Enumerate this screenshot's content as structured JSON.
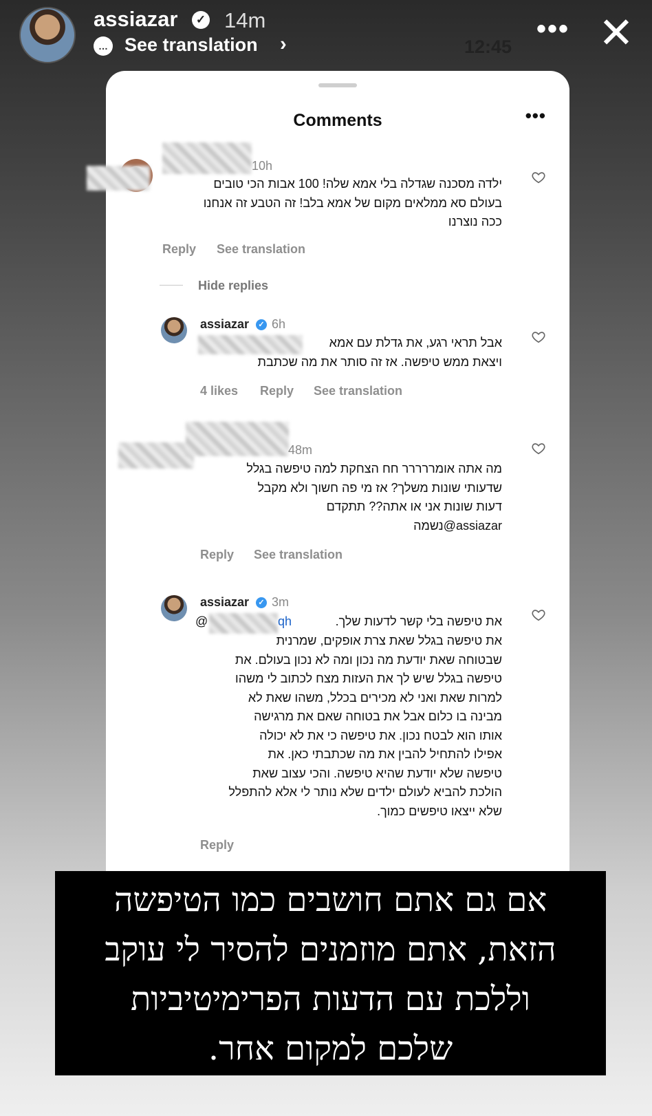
{
  "story": {
    "username": "assiazar",
    "verified_glyph": "✓",
    "time_ago": "14m",
    "see_translation": "See translation",
    "chevron": "›",
    "clock": "12:45",
    "more": "•••",
    "close": "✕"
  },
  "sheet": {
    "title": "Comments",
    "more": "•••"
  },
  "comments": [
    {
      "time": "10h",
      "text": "ילדה מסכנה שגדלה בלי אמא שלה! 100 אבות הכי טובים\nבעולם סא ממלאים מקום של אמא בלב! זה הטבע זה אנחנו\nככה נוצרנו",
      "reply": "Reply",
      "see_translation": "See translation"
    },
    {
      "hide_replies": "Hide replies"
    },
    {
      "username": "assiazar",
      "time": "6h",
      "text": "אבל תראי רגע, את גדלת עם אמא\nויצאת ממש טיפשה. אז זה סותר את מה שכתבת",
      "likes": "4 likes",
      "reply": "Reply",
      "see_translation": "See translation"
    },
    {
      "time": "48m",
      "text": "מה אתה אומררררר חח הצחקת למה טיפשה בגלל\nשדעותי שונות משלך? אז מי פה חשוך ולא מקבל\nדעות שונות אני או אתה?? תתקדם\nassiazar@נשמה",
      "reply": "Reply",
      "see_translation": "See translation"
    },
    {
      "username": "assiazar",
      "time": "3m",
      "mention_prefix": "@",
      "mention_suffix": "qh",
      "first_line": "את טיפשה בלי קשר לדעות שלך.",
      "text": "את טיפשה בגלל שאת צרת אופקים, שמרנית\nשבטוחה שאת יודעת מה נכון ומה לא נכון בעולם. את\nטיפשה בגלל שיש לך את העזות מצח לכתוב לי משהו\nלמרות שאת ואני לא מכירים בכלל, משהו שאת לא\nמבינה בו כלום אבל את בטוחה שאם את מרגישה\nאותו הוא לבטח נכון. את טיפשה כי את לא יכולה\nאפילו להתחיל להבין את מה שכתבתי כאן. את\nטיפשה שלא יודעת שהיא טיפשה. והכי עצוב שאת\nהולכת להביא לעולם ילדים שלא נותר לי אלא להתפלל\nשלא ייצאו טיפשים כמוך.",
      "reply": "Reply"
    }
  ],
  "caption": {
    "text": "אם גם אתם חושבים כמו הטיפשה\nהזאת, אתם מוזמנים להסיר לי עוקב\nוללכת עם הדעות הפרימיטיביות\nשלכם למקום אחר."
  },
  "icons": {
    "heart": "heart-icon",
    "verified": "verified-badge-icon",
    "translate": "speech-bubble-icon",
    "close": "close-icon"
  },
  "colors": {
    "mention": "#1a62c8",
    "verified": "#3897f0",
    "muted": "#8e8e8e"
  }
}
